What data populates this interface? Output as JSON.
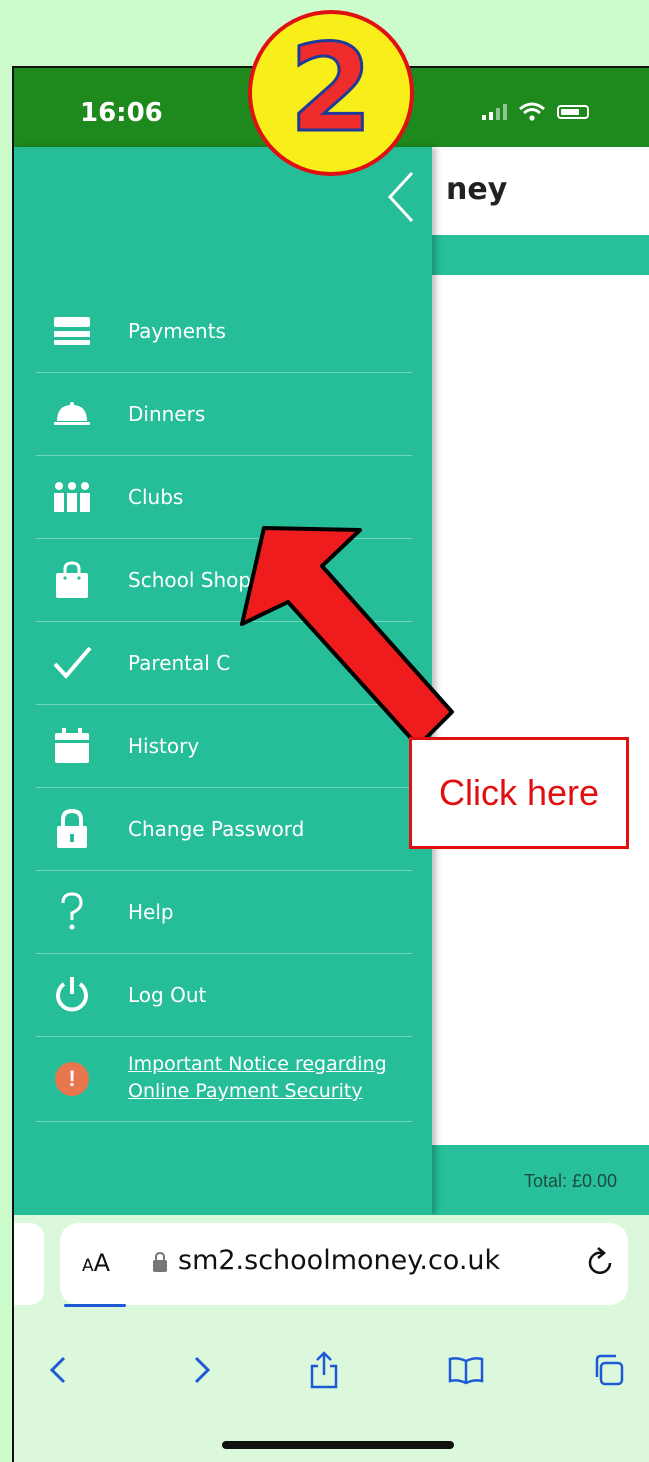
{
  "status": {
    "time": "16:06"
  },
  "app": {
    "title_partial": "ney",
    "total": "Total: £0.00"
  },
  "menu": {
    "items": [
      {
        "label": "Payments"
      },
      {
        "label": "Dinners"
      },
      {
        "label": "Clubs"
      },
      {
        "label": "School Shop"
      },
      {
        "label": "Parental C"
      },
      {
        "label": "History"
      },
      {
        "label": "Change Password"
      },
      {
        "label": "Help"
      },
      {
        "label": "Log Out"
      }
    ],
    "notice": {
      "line1": "Important Notice regarding",
      "line2": "Online Payment Security"
    }
  },
  "browser": {
    "aa_small": "A",
    "aa_large": "A",
    "url": "sm2.schoolmoney.co.uk"
  },
  "annotation": {
    "step_number": "2",
    "callout": "Click here"
  },
  "colors": {
    "drawer": "#26be98",
    "statusbar": "#1e8a1e",
    "page_bg": "#ccfccc",
    "accent_red": "#e01010"
  }
}
